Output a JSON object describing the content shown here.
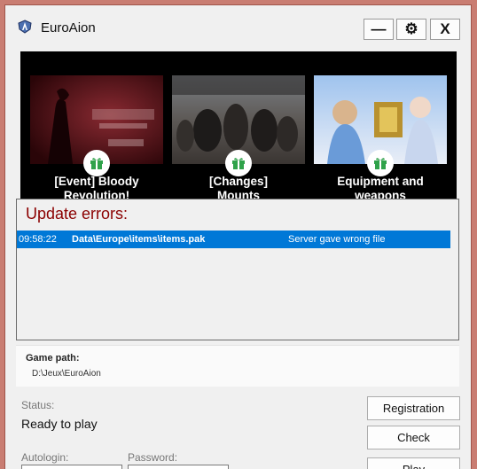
{
  "window": {
    "title": "EuroAion"
  },
  "controls": {
    "minimize": "—",
    "settings": "⚙",
    "close": "X"
  },
  "news": [
    {
      "caption_line1": "[Event] Bloody",
      "caption_line2": "Revolution!"
    },
    {
      "caption_line1": "[Changes]",
      "caption_line2": "Mounts"
    },
    {
      "caption_line1": "Equipment and",
      "caption_line2": "weapons"
    }
  ],
  "update_errors": {
    "heading": "Update errors:",
    "rows": [
      {
        "time": "09:58:22",
        "file": "Data\\Europe\\items\\items.pak",
        "message": "Server gave wrong file"
      }
    ]
  },
  "game_path": {
    "label": "Game path:",
    "value": "D:\\Jeux\\EuroAion"
  },
  "status": {
    "label": "Status:",
    "value": "Ready to play"
  },
  "login": {
    "autologin_label": "Autologin:",
    "password_label": "Password:"
  },
  "buttons": {
    "registration": "Registration",
    "check": "Check",
    "play": "Play"
  },
  "colors": {
    "frame": "#c97d72",
    "selection": "#0078d7",
    "error_heading": "#8b0000",
    "gift": "#2fa24a"
  }
}
